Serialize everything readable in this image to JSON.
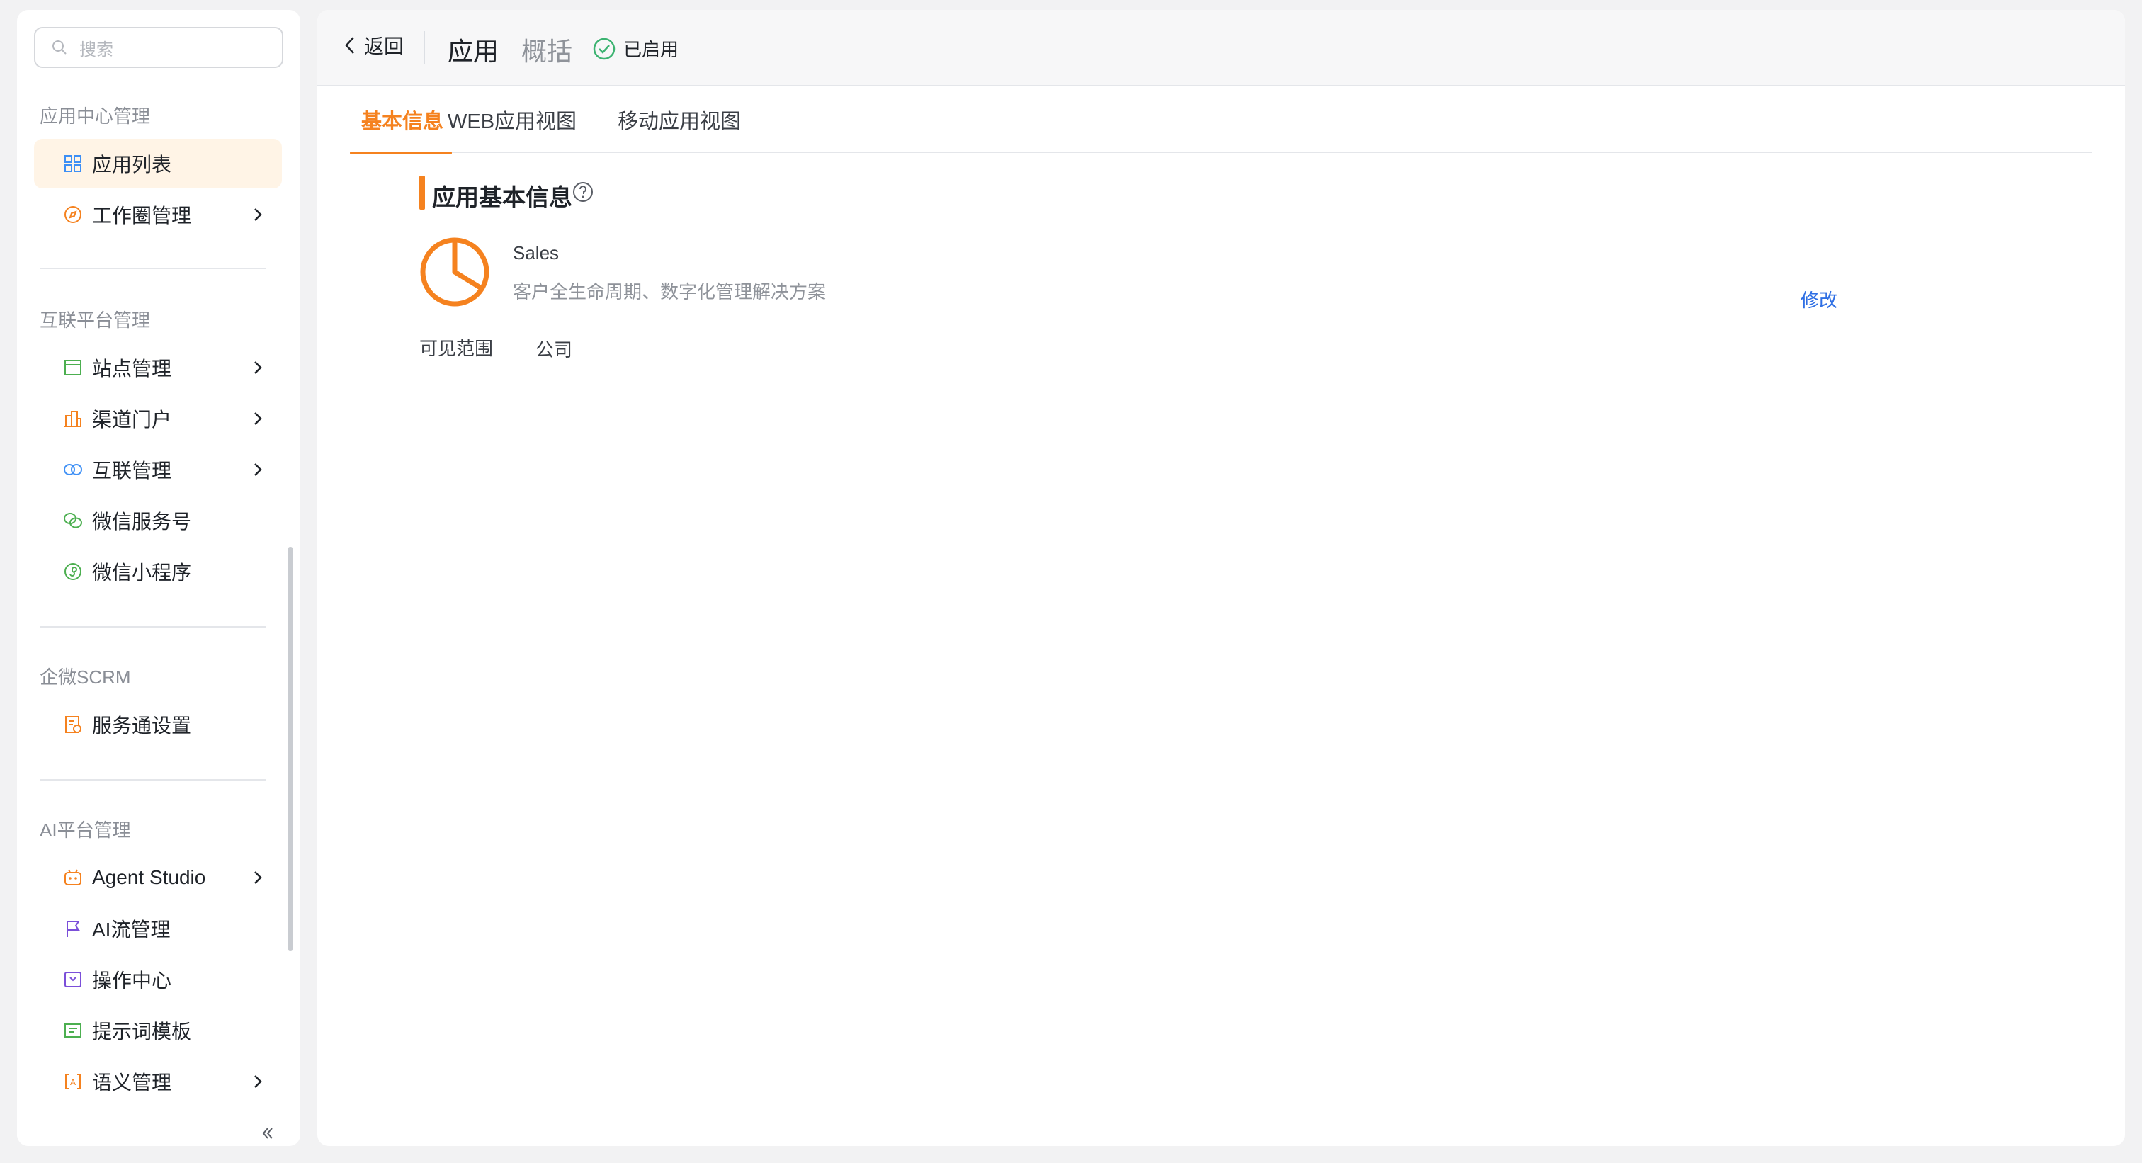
{
  "search": {
    "placeholder": "搜索"
  },
  "sidebar": {
    "sections": [
      {
        "title": "应用中心管理",
        "items": [
          {
            "label": "应用列表",
            "icon": "grid-icon",
            "active": true
          },
          {
            "label": "工作圈管理",
            "icon": "compass-icon",
            "expandable": true
          }
        ]
      },
      {
        "title": "互联平台管理",
        "items": [
          {
            "label": "站点管理",
            "icon": "site-icon",
            "expandable": true
          },
          {
            "label": "渠道门户",
            "icon": "building-icon",
            "expandable": true
          },
          {
            "label": "互联管理",
            "icon": "link-rings-icon",
            "expandable": true
          },
          {
            "label": "微信服务号",
            "icon": "wechat-icon"
          },
          {
            "label": "微信小程序",
            "icon": "miniprogram-icon"
          }
        ]
      },
      {
        "title": "企微SCRM",
        "items": [
          {
            "label": "服务通设置",
            "icon": "service-doc-icon"
          }
        ]
      },
      {
        "title": "AI平台管理",
        "items": [
          {
            "label": "Agent Studio",
            "icon": "robot-icon",
            "expandable": true
          },
          {
            "label": "AI流管理",
            "icon": "flag-icon"
          },
          {
            "label": "操作中心",
            "icon": "operation-icon"
          },
          {
            "label": "提示词模板",
            "icon": "template-icon"
          },
          {
            "label": "语义管理",
            "icon": "semantic-icon",
            "expandable": true
          }
        ]
      }
    ]
  },
  "header": {
    "back_label": "返回",
    "title": "应用",
    "subtitle": "概括",
    "status": "已启用"
  },
  "tabs": [
    {
      "label": "基本信息",
      "active": true
    },
    {
      "label": "WEB应用视图"
    },
    {
      "label": "移动应用视图"
    }
  ],
  "content": {
    "section_title": "应用基本信息",
    "app": {
      "name": "Sales",
      "description": "客户全生命周期、数字化管理解决方案",
      "icon": "pie-clock-icon"
    },
    "edit_label": "修改",
    "visibility_label": "可见范围",
    "visibility_value": "公司"
  },
  "colors": {
    "accent": "#f5821f",
    "active_bg": "#fff4e6",
    "link": "#2f6fe4",
    "status_ok": "#3cb371"
  }
}
